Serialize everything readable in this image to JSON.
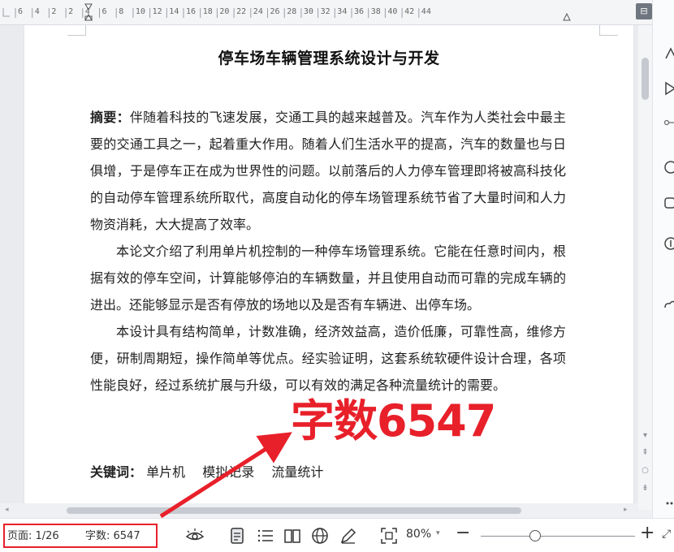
{
  "ruler": {
    "numbers": [
      "6",
      "4",
      "2",
      "2",
      "4",
      "6",
      "8",
      "10",
      "12",
      "14",
      "16",
      "18",
      "20",
      "22",
      "24",
      "26",
      "28",
      "30",
      "32",
      "34",
      "36",
      "38",
      "40",
      "42",
      "44"
    ]
  },
  "document": {
    "title": "停车场车辆管理系统设计与开发",
    "abstract_label": "摘要：",
    "abstract_text": "伴随着科技的飞速发展，交通工具的越来越普及。汽车作为人类社会中最主要的交通工具之一，起着重大作用。随着人们生活水平的提高，汽车的数量也与日俱增，于是停车正在成为世界性的问题。以前落后的人力停车管理即将被高科技化的自动停车管理系统所取代，高度自动化的停车场管理系统节省了大量时间和人力物资消耗，大大提高了效率。",
    "para_intro": "本论文介绍了利用单片机控制的一种停车场管理系统。它能在任意时间内，根据有效的停车空间，计算能够停泊的车辆数量，并且使用自动而可靠的完成车辆的进出。还能够显示是否有停放的场地以及是否有车辆进、出停车场。",
    "para_design": "本设计具有结构简单，计数准确，经济效益高，造价低廉，可靠性高，维修方便，研制周期短，操作简单等优点。经实验证明，这套系统软硬件设计合理，各项性能良好，经过系统扩展与升级，可以有效的满足各种流量统计的需要。",
    "keywords_label": "关键词：",
    "keywords": [
      "单片机",
      "模拟记录",
      "流量统计"
    ]
  },
  "annotation": {
    "text": "字数6547",
    "color": "#e8202a"
  },
  "statusbar": {
    "page": "页面: 1/26",
    "words": "字数: 6547",
    "zoom": "80%"
  },
  "icons": {
    "toolbar": [
      "eye-icon",
      "page-view-icon",
      "outline-view-icon",
      "read-mode-icon",
      "web-view-icon",
      "pen-icon",
      "fit-page-icon"
    ],
    "sidebar": [
      "shape-icon",
      "select-icon",
      "link-icon",
      "help-icon",
      "share-icon",
      "settings-icon",
      "cloud-icon",
      "more-icon"
    ]
  },
  "colors": {
    "accent": "#e8202a",
    "page_bg": "#ffffff",
    "canvas_bg": "#e9ebef"
  }
}
